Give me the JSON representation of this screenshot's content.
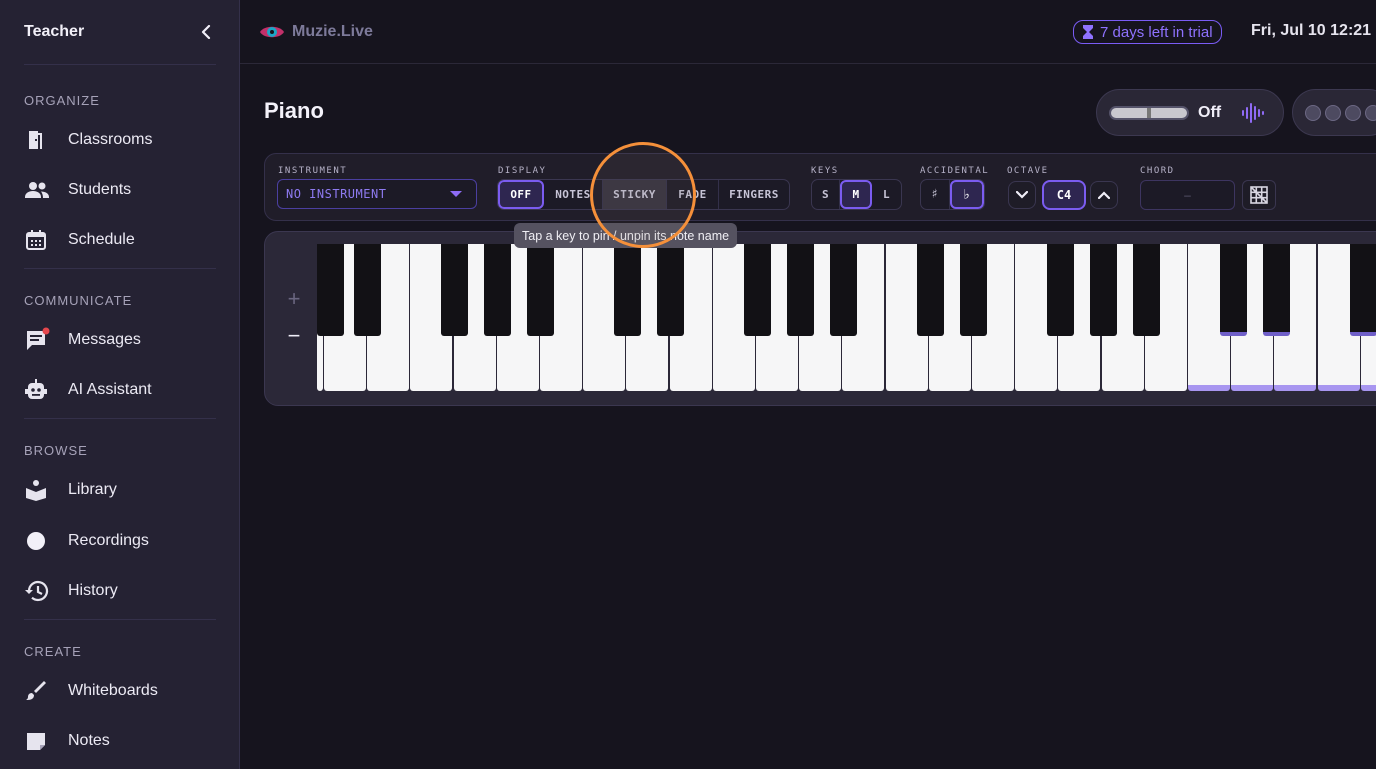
{
  "sidebar": {
    "title": "Teacher",
    "sections": [
      {
        "label": "ORGANIZE",
        "items": [
          {
            "label": "Classrooms",
            "icon": "door-icon"
          },
          {
            "label": "Students",
            "icon": "people-icon"
          },
          {
            "label": "Schedule",
            "icon": "calendar-icon"
          }
        ]
      },
      {
        "label": "COMMUNICATE",
        "items": [
          {
            "label": "Messages",
            "icon": "message-icon"
          },
          {
            "label": "AI Assistant",
            "icon": "robot-icon"
          }
        ]
      },
      {
        "label": "BROWSE",
        "items": [
          {
            "label": "Library",
            "icon": "book-icon"
          },
          {
            "label": "Recordings",
            "icon": "record-icon"
          },
          {
            "label": "History",
            "icon": "history-icon"
          }
        ]
      },
      {
        "label": "CREATE",
        "items": [
          {
            "label": "Whiteboards",
            "icon": "brush-icon"
          },
          {
            "label": "Notes",
            "icon": "note-icon"
          }
        ]
      }
    ]
  },
  "topbar": {
    "logo_text": "Muzie.Live",
    "trial_text": "7 days left in trial",
    "datetime": "Fri, Jul 10 12:21"
  },
  "page": {
    "title": "Piano"
  },
  "mic": {
    "status": "Off"
  },
  "controls": {
    "instrument": {
      "label": "INSTRUMENT",
      "value": "NO INSTRUMENT"
    },
    "display": {
      "label": "DISPLAY",
      "options": [
        "OFF",
        "NOTES",
        "STICKY",
        "FADE",
        "FINGERS"
      ],
      "selected": "OFF",
      "hovered": "STICKY"
    },
    "keys": {
      "label": "KEYS",
      "options": [
        "S",
        "M",
        "L"
      ],
      "selected": "M"
    },
    "accidental": {
      "label": "ACCIDENTAL",
      "options": [
        "♯",
        "♭"
      ],
      "selected": "♭"
    },
    "octave": {
      "label": "OCTAVE",
      "value": "C4"
    },
    "chord": {
      "label": "CHORD",
      "value": "–"
    }
  },
  "tooltip": "Tap a key to pin / unpin its note name",
  "zoom": {
    "plus": "+",
    "minus": "−"
  },
  "colors": {
    "accent": "#7b5cf0",
    "trial": "#8f72ff",
    "highlight_ring": "#f5903a",
    "key_highlight": "#a896f0"
  }
}
